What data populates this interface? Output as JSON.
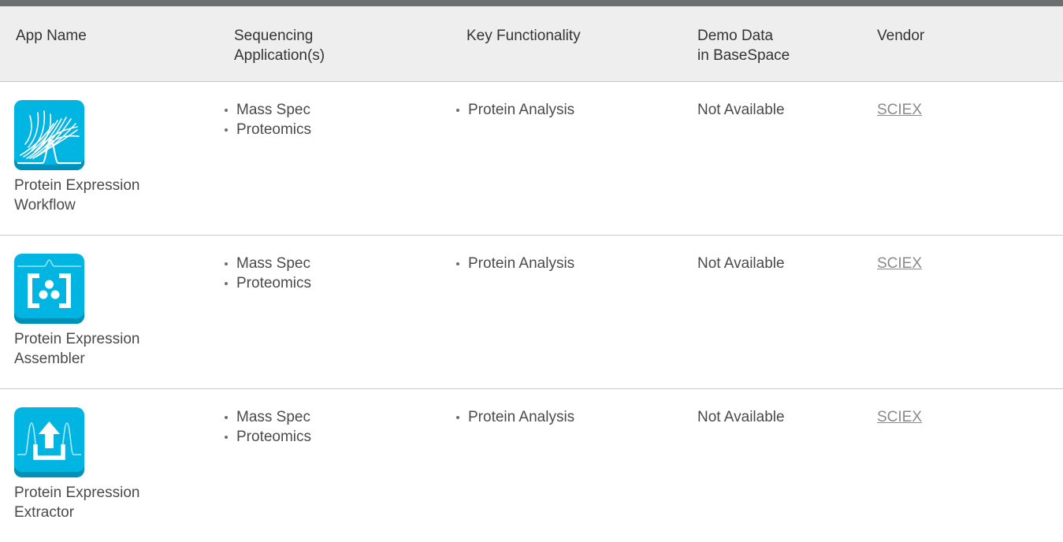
{
  "table": {
    "columns": [
      {
        "label": "App Name"
      },
      {
        "label_line1": "Sequencing",
        "label_line2": "Application(s)"
      },
      {
        "label": "Key Functionality"
      },
      {
        "label_line1": "Demo Data",
        "label_line2": "in BaseSpace"
      },
      {
        "label": "Vendor"
      }
    ],
    "rows": [
      {
        "icon": "protein-expression-workflow-icon",
        "name_line1": "Protein Expression",
        "name_line2": "Workflow",
        "applications": [
          "Mass Spec",
          "Proteomics"
        ],
        "functionality": [
          "Protein Analysis"
        ],
        "demo_data": "Not Available",
        "vendor": "SCIEX"
      },
      {
        "icon": "protein-expression-assembler-icon",
        "name_line1": "Protein Expression",
        "name_line2": "Assembler",
        "applications": [
          "Mass Spec",
          "Proteomics"
        ],
        "functionality": [
          "Protein Analysis"
        ],
        "demo_data": "Not Available",
        "vendor": "SCIEX"
      },
      {
        "icon": "protein-expression-extractor-icon",
        "name_line1": "Protein Expression",
        "name_line2": "Extractor",
        "applications": [
          "Mass Spec",
          "Proteomics"
        ],
        "functionality": [
          "Protein Analysis"
        ],
        "demo_data": "Not Available",
        "vendor": "SCIEX"
      }
    ]
  },
  "colors": {
    "icon_background": "#00b5e2",
    "header_background": "#eeeeee",
    "top_bar": "#6d6e71",
    "link": "#8a8a8a"
  }
}
